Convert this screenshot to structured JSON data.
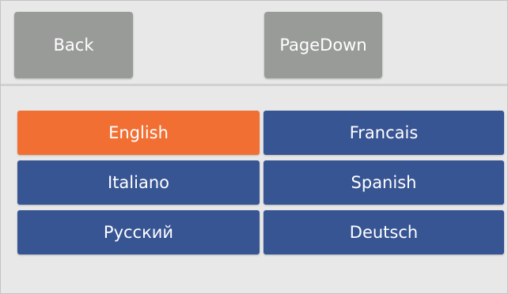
{
  "toolbar": {
    "back_label": "Back",
    "pagedown_label": "PageDown"
  },
  "languages": [
    {
      "label": "English",
      "selected": true
    },
    {
      "label": "Francais",
      "selected": false
    },
    {
      "label": "Italiano",
      "selected": false
    },
    {
      "label": "Spanish",
      "selected": false
    },
    {
      "label": "Русский",
      "selected": false
    },
    {
      "label": "Deutsch",
      "selected": false
    }
  ],
  "colors": {
    "background": "#e8e8e8",
    "toolbar_button": "#999b99",
    "language_button": "#375493",
    "selected_language": "#f26f33",
    "text": "#ffffff"
  }
}
